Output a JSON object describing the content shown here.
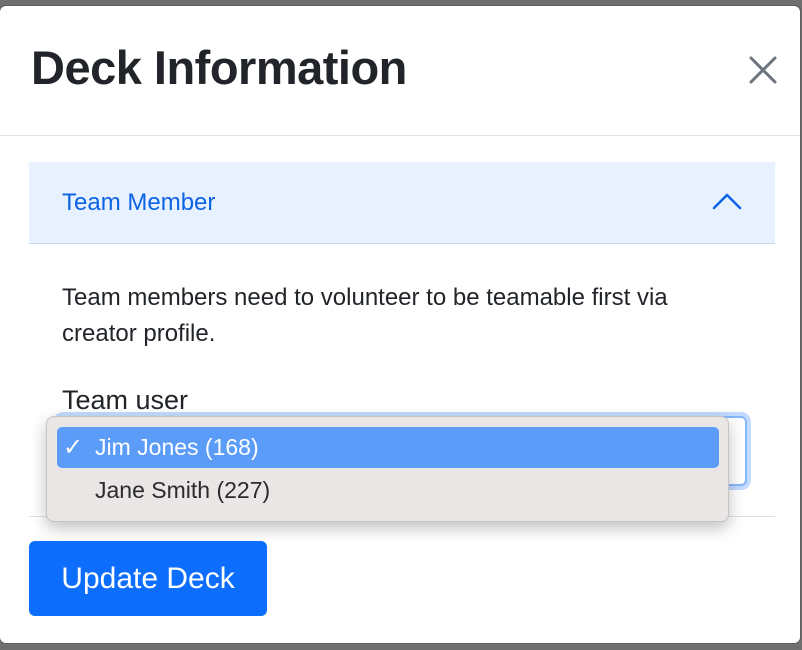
{
  "modal": {
    "title": "Deck Information",
    "close_icon": "close-icon"
  },
  "accordion": {
    "header_label": "Team Member",
    "toggle_icon": "chevron-up-icon",
    "help_text": "Team members need to volunteer to be teamable first via creator profile.",
    "field_label": "Team user"
  },
  "dropdown": {
    "options": [
      {
        "label": "Jim Jones (168)",
        "selected": true,
        "check": "✓"
      },
      {
        "label": "Jane Smith (227)",
        "selected": false
      }
    ]
  },
  "footer": {
    "update_label": "Update Deck"
  },
  "colors": {
    "accent": "#0d6efd",
    "accordion_bg": "#e7f1ff",
    "accordion_text": "#0c63e4",
    "selected_option_bg": "#5a9cf8"
  }
}
